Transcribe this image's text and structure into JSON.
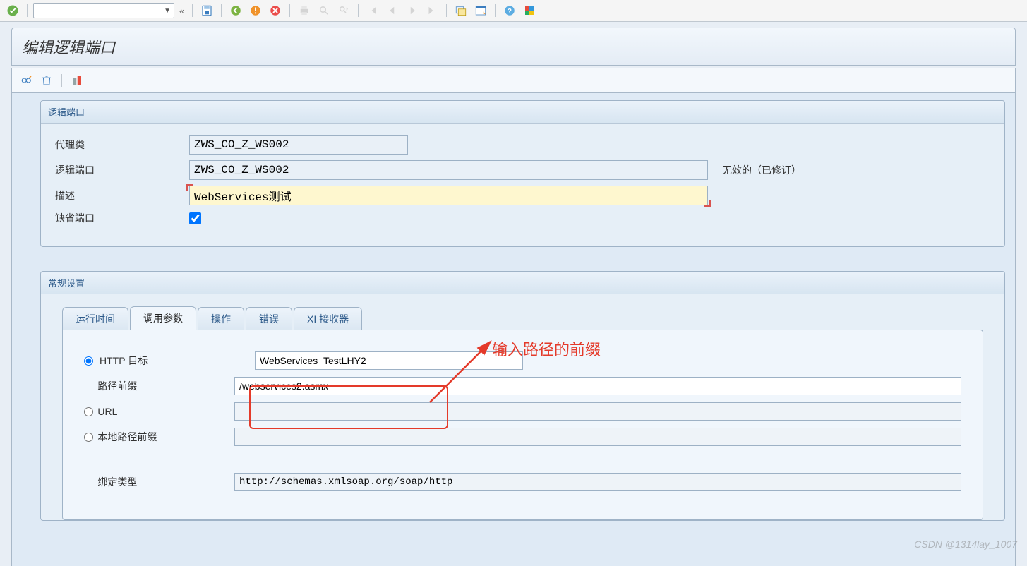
{
  "toolbar": {
    "ok": "✓",
    "command_placeholder": "",
    "icons": {
      "save": "save-icon",
      "back": "back-icon",
      "end": "end-icon",
      "cancel": "cancel-icon",
      "print": "print-icon",
      "find": "find-icon",
      "findnext": "findnext-icon",
      "first": "first-icon",
      "prevpage": "prevpage-icon",
      "nextpage": "nextpage-icon",
      "last": "last-icon",
      "session": "session-icon",
      "layout": "layout-icon",
      "help": "help-icon",
      "color": "color-icon"
    }
  },
  "title": "编辑逻辑端口",
  "subtoolbar": {
    "edit": "edit-icon",
    "delete": "delete-icon",
    "active": "active-icon"
  },
  "group1": {
    "legend": "逻辑端口",
    "rows": {
      "proxy_class_label": "代理类",
      "proxy_class_value": "ZWS_CO_Z_WS002",
      "logical_port_label": "逻辑端口",
      "logical_port_value": "ZWS_CO_Z_WS002",
      "logical_port_badge": "无效的（已修订）",
      "desc_label": "描述",
      "desc_value": "WebServices测试",
      "default_label": "缺省端口",
      "default_checked": true
    }
  },
  "group2": {
    "legend": "常规设置",
    "tabs": [
      "运行时间",
      "调用参数",
      "操作",
      "错误",
      "XI 接收器"
    ],
    "active_tab": 1,
    "params": {
      "http_target_label": "HTTP 目标",
      "http_target_value": "WebServices_TestLHY2",
      "path_prefix_label": "路径前缀",
      "path_prefix_value": "/webservices2.asmx",
      "url_label": "URL",
      "url_value": "",
      "local_prefix_label": "本地路径前缀",
      "local_prefix_value": "",
      "binding_label": "绑定类型",
      "binding_value": "http://schemas.xmlsoap.org/soap/http"
    }
  },
  "annotation": {
    "text": "输入路径的前缀"
  },
  "watermark": "CSDN @1314lay_1007"
}
